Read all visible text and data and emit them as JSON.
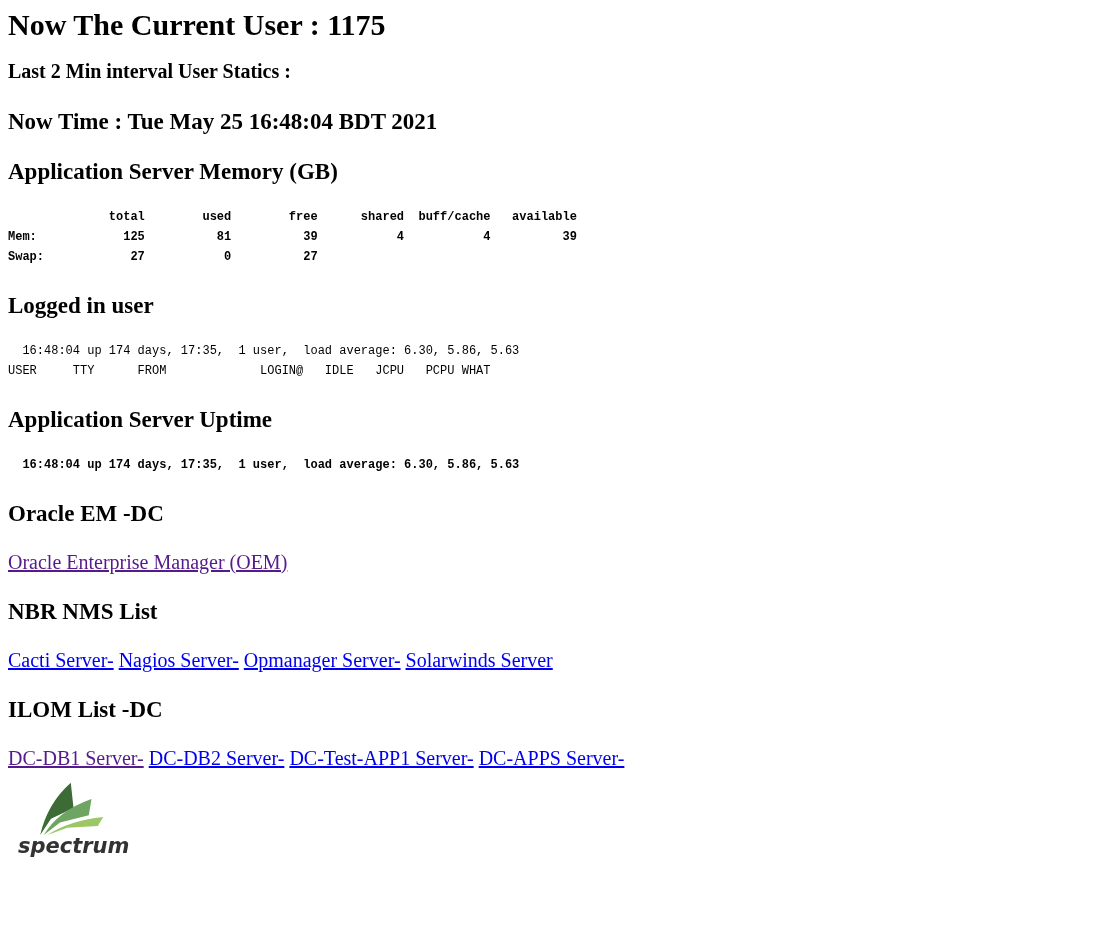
{
  "blocks": [
    {
      "kind": "h1",
      "text": "Now The Current User : 1175"
    },
    {
      "kind": "h4",
      "text": "Last 2 Min interval User Statics :"
    },
    {
      "kind": "h3",
      "text": "Now Time : Tue May 25 16:48:04 BDT 2021"
    },
    {
      "kind": "h3",
      "text": "Application Server Memory (GB)"
    },
    {
      "kind": "pre",
      "bold": true,
      "lines": [
        "              total        used        free      shared  buff/cache   available",
        "Mem:            125          81          39           4           4          39",
        "Swap:            27           0          27"
      ]
    },
    {
      "kind": "h3",
      "text": "Logged in user"
    },
    {
      "kind": "pre",
      "bold": false,
      "lines": [
        "  16:48:04 up 174 days, 17:35,  1 user,  load average: 6.30, 5.86, 5.63",
        "USER     TTY      FROM             LOGIN@   IDLE   JCPU   PCPU WHAT"
      ]
    },
    {
      "kind": "h3",
      "text": "Application Server Uptime"
    },
    {
      "kind": "pre",
      "bold": true,
      "lines": [
        "  16:48:04 up 174 days, 17:35,  1 user,  load average: 6.30, 5.86, 5.63"
      ]
    },
    {
      "kind": "h3",
      "text": "Oracle EM -DC"
    },
    {
      "kind": "links",
      "links": [
        {
          "text": "Oracle Enterprise Manager (OEM)",
          "visited": true
        }
      ]
    },
    {
      "kind": "h3",
      "text": "NBR NMS List"
    },
    {
      "kind": "links",
      "links": [
        {
          "text": "Cacti Server-",
          "visited": false
        },
        {
          "text": "Nagios Server-",
          "visited": false
        },
        {
          "text": "Opmanager Server-",
          "visited": false
        },
        {
          "text": "Solarwinds Server",
          "visited": false
        }
      ]
    },
    {
      "kind": "h3",
      "text": "ILOM List -DC"
    },
    {
      "kind": "links",
      "links": [
        {
          "text": "DC-DB1 Server-",
          "visited": true
        },
        {
          "text": "DC-DB2 Server-",
          "visited": false
        },
        {
          "text": "DC-Test-APP1 Server-",
          "visited": false
        },
        {
          "text": "DC-APPS Server-",
          "visited": false
        }
      ]
    },
    {
      "kind": "logo",
      "text": "spectrum"
    }
  ]
}
